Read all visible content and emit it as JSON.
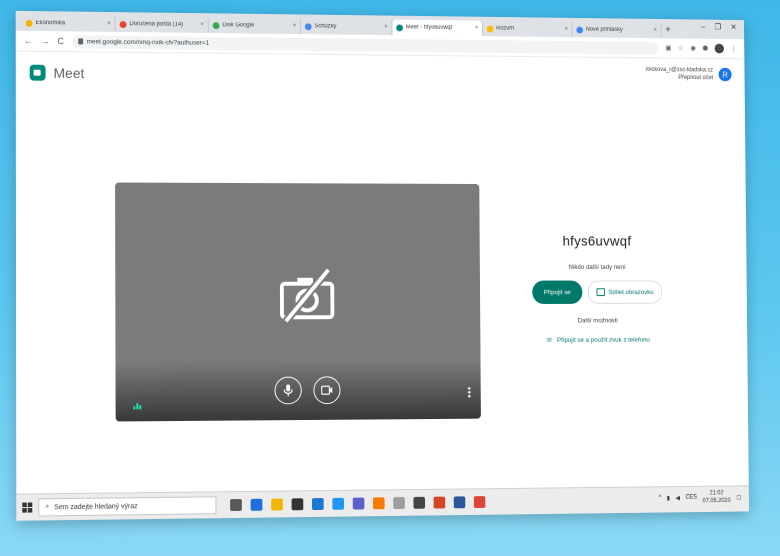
{
  "browser": {
    "tabs": [
      {
        "label": "Ekonomika",
        "color": "#f4b400",
        "active": false
      },
      {
        "label": "Doručená pošta (14)",
        "color": "#ea4335",
        "active": false
      },
      {
        "label": "Disk Google",
        "color": "#34a853",
        "active": false
      },
      {
        "label": "Schůzky",
        "color": "#4285f4",
        "active": false
      },
      {
        "label": "Meet - hfys6uvwqf",
        "color": "#00897b",
        "active": true
      },
      {
        "label": "Rozvrh",
        "color": "#fbbc04",
        "active": false
      },
      {
        "label": "Nové přihlášky",
        "color": "#4285f4",
        "active": false
      }
    ],
    "url": "meet.google.com/nmq-nxik-cfv?authuser=1",
    "window_controls": {
      "min": "–",
      "max": "❐",
      "close": "✕"
    },
    "nav": {
      "back": "←",
      "forward": "→",
      "reload": "C"
    },
    "profile_initial": "S",
    "new_tab": "+"
  },
  "meet": {
    "title": "Meet",
    "account_email": "mickova_r@zsc-kladska.cz",
    "switch_account": "Přepnout účet",
    "avatar_initial": "R",
    "meeting_code": "hfys6uvwqf",
    "nobody_here": "Nikdo další tady není",
    "join_label": "Připojit se",
    "share_label": "Sdílet obrazovku",
    "more_options": "Další možnosti",
    "phone_label": "Připojit se a použít zvuk z telefonu"
  },
  "taskbar": {
    "search_placeholder": "Sem zadejte hledaný výraz",
    "time": "21:02",
    "date": "07.05.2020",
    "lang": "CES",
    "apps": [
      {
        "name": "task-view",
        "color": "#5a5a5a"
      },
      {
        "name": "edge",
        "color": "#1e6fd9"
      },
      {
        "name": "explorer",
        "color": "#f2b705"
      },
      {
        "name": "store",
        "color": "#333333"
      },
      {
        "name": "mail",
        "color": "#1976d2"
      },
      {
        "name": "lms",
        "color": "#2196f3"
      },
      {
        "name": "teams",
        "color": "#5b5fc7"
      },
      {
        "name": "files",
        "color": "#f57c00"
      },
      {
        "name": "chat",
        "color": "#9e9e9e"
      },
      {
        "name": "settings",
        "color": "#444444"
      },
      {
        "name": "powerpoint",
        "color": "#d24726"
      },
      {
        "name": "word",
        "color": "#2b579a"
      },
      {
        "name": "chrome",
        "color": "#db4437"
      }
    ]
  }
}
